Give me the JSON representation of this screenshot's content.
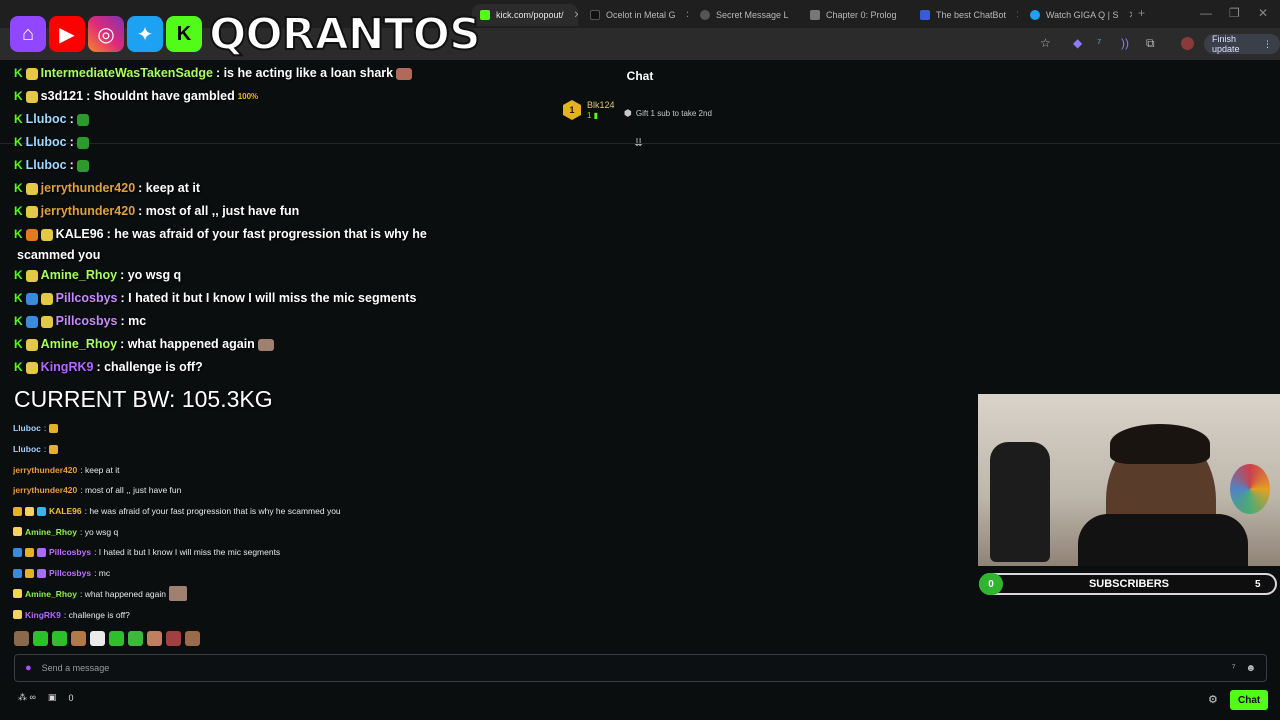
{
  "browser": {
    "tabs": [
      {
        "label": "kick.com/popout/",
        "active": true,
        "fav": "#53fc18"
      },
      {
        "label": "Ocelot in Metal G",
        "active": false,
        "fav": "#111"
      },
      {
        "label": "Secret Message L",
        "active": false,
        "fav": "#555"
      },
      {
        "label": "Chapter 0: Prolog",
        "active": false,
        "fav": "#777"
      },
      {
        "label": "The best ChatBot",
        "active": false,
        "fav": "#3a5bd9"
      },
      {
        "label": "Watch GIGA Q | S",
        "active": false,
        "fav": "#1da1f2"
      }
    ],
    "finish_update": "Finish update"
  },
  "banner": {
    "brand": "QORANTOS"
  },
  "chat": {
    "title": "Chat",
    "top_gifter": {
      "rank": "1",
      "name": "Blk124",
      "count": "1"
    },
    "gift_cta": "Gift 1 sub to take 2nd"
  },
  "overlay_lines": [
    {
      "user": "IntermediateWasTakenSadge",
      "text": ": is he acting like a loan shark",
      "color": "#a6ff5e"
    },
    {
      "user": "s3d121",
      "text": ": Shouldnt have gambled",
      "color": "#ffffff"
    },
    {
      "user": "Lluboc",
      "text": ":",
      "color": "#a0d8ff"
    },
    {
      "user": "Lluboc",
      "text": ":",
      "color": "#a0d8ff"
    },
    {
      "user": "Lluboc",
      "text": ":",
      "color": "#a0d8ff"
    },
    {
      "user": "jerrythunder420",
      "text": ":  keep at it",
      "color": "#e0a040"
    },
    {
      "user": "jerrythunder420",
      "text": ": most of all ,, just have fun",
      "color": "#e0a040"
    },
    {
      "user": "KALE96",
      "text": ": he was afraid of your fast progression that is why he",
      "color": "#ffffff"
    }
  ],
  "overlay_wrap": "scammed you",
  "overlay_lines2": [
    {
      "user": "Amine_Rhoy",
      "text": ": yo wsg q",
      "color": "#a6ff5e"
    },
    {
      "user": "Pillcosbys",
      "text": ": I hated it but I know I will miss the mic segments",
      "color": "#c58bff"
    },
    {
      "user": "Pillcosbys",
      "text": ": mc",
      "color": "#c58bff"
    },
    {
      "user": "Amine_Rhoy",
      "text": ": what happened again",
      "color": "#a6ff5e"
    },
    {
      "user": "KingRK9",
      "text": ": challenge is off?",
      "color": "#b468ff"
    }
  ],
  "current_bw": "CURRENT BW: 105.3KG",
  "messages": [
    {
      "user": "Lluboc",
      "text": ":",
      "color": "#9fd3ff"
    },
    {
      "user": "Lluboc",
      "text": ":",
      "color": "#9fd3ff"
    },
    {
      "user": "jerrythunder420",
      "text": ":  keep at it",
      "color": "#e89a3c"
    },
    {
      "user": "jerrythunder420",
      "text": ": most of all ,, just have fun",
      "color": "#e89a3c"
    },
    {
      "user": "KALE96",
      "text": ": he was afraid of your fast progression that is why he scammed you",
      "color": "#f0c030"
    },
    {
      "user": "Amine_Rhoy",
      "text": ": yo wsg q",
      "color": "#8cf04a"
    },
    {
      "user": "Pillcosbys",
      "text": ": I hated it but I know I will miss the mic segments",
      "color": "#c070ff"
    },
    {
      "user": "Pillcosbys",
      "text": ": mc",
      "color": "#c070ff"
    },
    {
      "user": "Amine_Rhoy",
      "text": ": what happened again",
      "color": "#8cf04a"
    },
    {
      "user": "KingRK9",
      "text": ": challenge is off?",
      "color": "#b468ff"
    }
  ],
  "subs_bar": {
    "current": "0",
    "label": "SUBSCRIBERS",
    "goal": "5",
    "progress": 0
  },
  "input": {
    "placeholder": "Send a message"
  },
  "footer": {
    "count": "0",
    "chat_button": "Chat"
  }
}
